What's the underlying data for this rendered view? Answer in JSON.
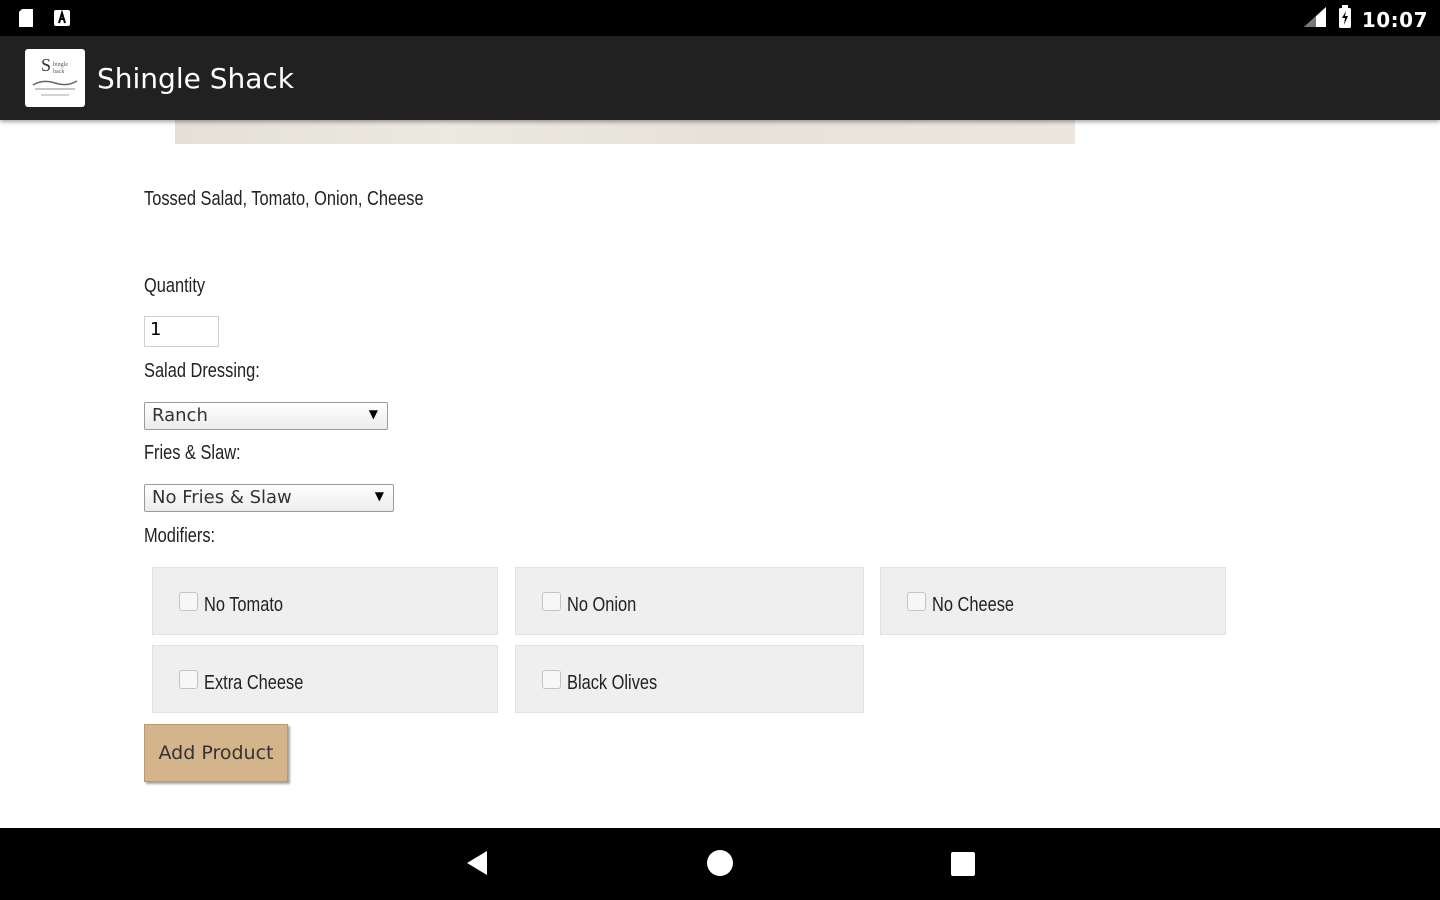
{
  "status_bar": {
    "time": "10:07",
    "left_icons": [
      "sd-card-icon",
      "app-notification-icon"
    ],
    "right_icons": [
      "signal-icon",
      "battery-icon"
    ]
  },
  "app_bar": {
    "title": "Shingle Shack",
    "logo_icon": "shingle-shack-logo"
  },
  "product": {
    "description": "Tossed Salad, Tomato, Onion, Cheese"
  },
  "form": {
    "quantity_label": "Quantity",
    "quantity_value": "1",
    "dressing_label": "Salad Dressing:",
    "dressing_selected": "Ranch",
    "fries_label": "Fries & Slaw:",
    "fries_selected": "No Fries & Slaw",
    "modifiers_label": "Modifiers:",
    "modifiers": [
      {
        "label": "No Tomato",
        "checked": false
      },
      {
        "label": "No Onion",
        "checked": false
      },
      {
        "label": "No Cheese",
        "checked": false
      },
      {
        "label": "Extra Cheese",
        "checked": false
      },
      {
        "label": "Black Olives",
        "checked": false
      }
    ],
    "add_button": "Add Product"
  },
  "colors": {
    "app_bar": "#212121",
    "button": "#d4b48a",
    "modifier_bg": "#efefef"
  },
  "nav_bar": {
    "icons": [
      "back-icon",
      "home-icon",
      "recents-icon"
    ]
  }
}
